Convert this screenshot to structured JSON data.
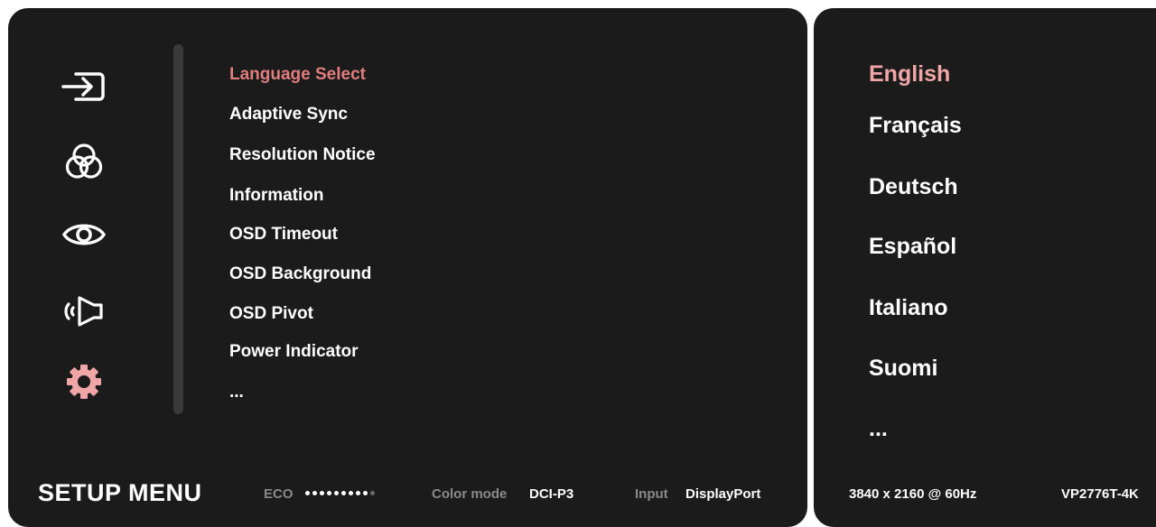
{
  "colors": {
    "panel_bg": "#1b1b1b",
    "accent": "#e07d7d",
    "accent_light": "#f0a6a6",
    "muted": "#8a8a8a",
    "text": "#ffffff"
  },
  "sidebar_icons": [
    {
      "name": "input-icon",
      "selected": false
    },
    {
      "name": "color-adjust-icon",
      "selected": false
    },
    {
      "name": "view-mode-icon",
      "selected": false
    },
    {
      "name": "audio-icon",
      "selected": false
    },
    {
      "name": "setup-gear-icon",
      "selected": true
    }
  ],
  "menu": {
    "items": [
      {
        "label": "Language Select",
        "selected": true
      },
      {
        "label": "Adaptive Sync",
        "selected": false
      },
      {
        "label": "Resolution Notice",
        "selected": false
      },
      {
        "label": "Information",
        "selected": false
      },
      {
        "label": "OSD Timeout",
        "selected": false
      },
      {
        "label": "OSD Background",
        "selected": false
      },
      {
        "label": "OSD Pivot",
        "selected": false
      },
      {
        "label": "Power Indicator",
        "selected": false
      },
      {
        "label": "...",
        "selected": false
      }
    ]
  },
  "footer": {
    "title": "SETUP MENU",
    "eco_label": "ECO",
    "eco_level": {
      "filled": 9,
      "total": 10
    },
    "color_mode_label": "Color mode",
    "color_mode_value": "DCI-P3",
    "input_label": "Input",
    "input_value": "DisplayPort"
  },
  "languages": {
    "items": [
      {
        "label": "English",
        "selected": true
      },
      {
        "label": "Français",
        "selected": false
      },
      {
        "label": "Deutsch",
        "selected": false
      },
      {
        "label": "Español",
        "selected": false
      },
      {
        "label": "Italiano",
        "selected": false
      },
      {
        "label": "Suomi",
        "selected": false
      },
      {
        "label": "...",
        "selected": false
      }
    ]
  },
  "side_footer": {
    "resolution": "3840 x 2160 @ 60Hz",
    "model": "VP2776T-4K"
  }
}
